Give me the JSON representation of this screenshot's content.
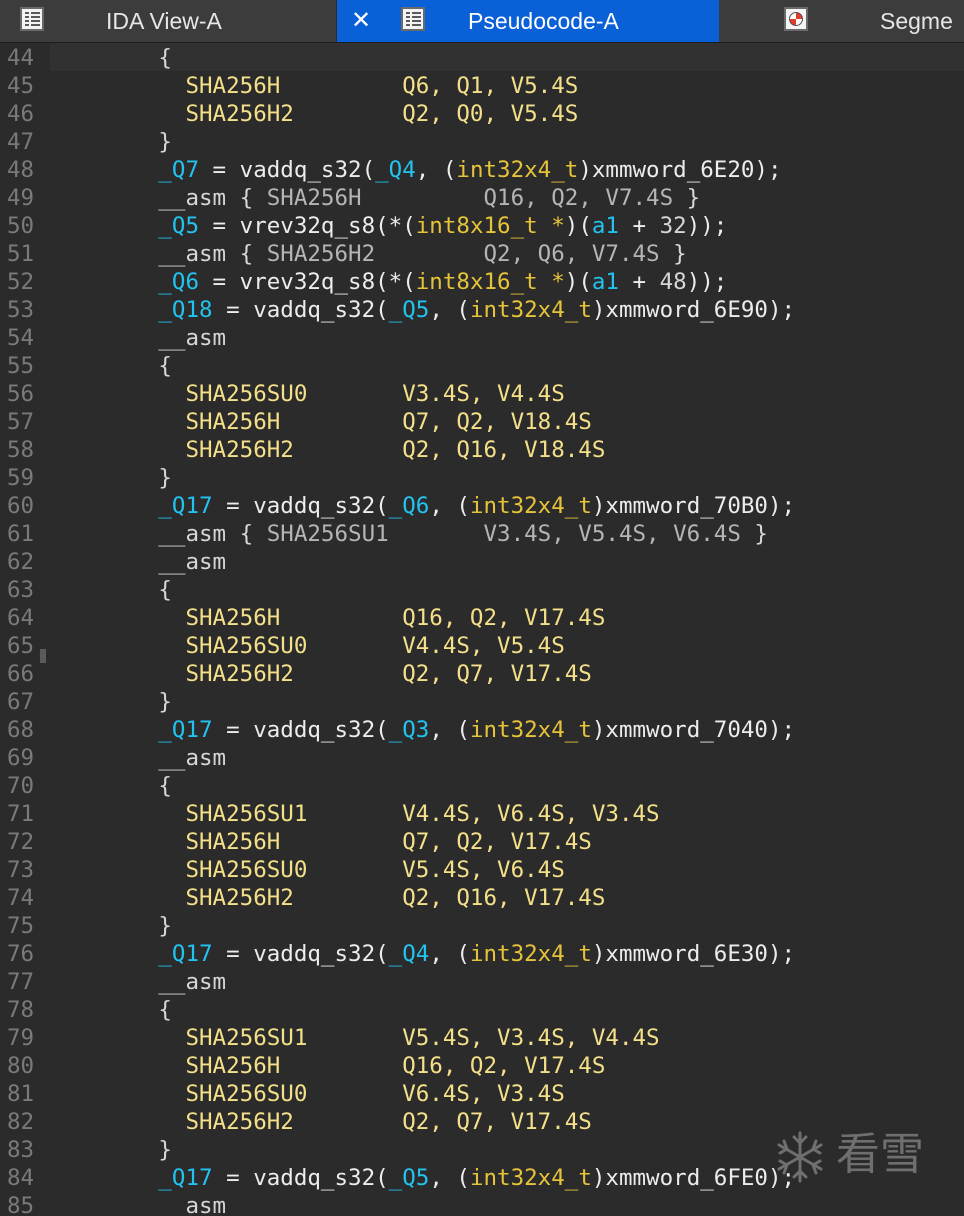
{
  "tabs": [
    {
      "label": "IDA View-A",
      "icon": "listing-icon",
      "active": false
    },
    {
      "label": "Pseudocode-A",
      "icon": "listing-icon",
      "active": true,
      "close": "✕"
    },
    {
      "label": "Segme",
      "icon": "segment-icon",
      "active": false
    }
  ],
  "colors": {
    "background": "#2b2b2b",
    "tab_active": "#0a60d6",
    "line_number": "#7a7a7a",
    "instruction": "#f5e08a",
    "variable": "#22c3ee",
    "type": "#e6c43a"
  },
  "code_lines": [
    {
      "n": "44",
      "tokens": [
        [
          "p",
          "        {"
        ]
      ]
    },
    {
      "n": "45",
      "tokens": [
        [
          "y",
          "          SHA256H         Q6, Q1, V5.4S"
        ]
      ]
    },
    {
      "n": "46",
      "tokens": [
        [
          "y",
          "          SHA256H2        Q2, Q0, V5.4S"
        ]
      ]
    },
    {
      "n": "47",
      "tokens": [
        [
          "p",
          "        }"
        ]
      ]
    },
    {
      "n": "48",
      "tokens": [
        [
          "p",
          "        "
        ],
        [
          "c",
          "_Q7"
        ],
        [
          "w",
          " = vaddq_s32("
        ],
        [
          "c",
          "_Q4"
        ],
        [
          "w",
          ", ("
        ],
        [
          "o",
          "int32x4_t"
        ],
        [
          "w",
          ")xmmword_6E20);"
        ]
      ]
    },
    {
      "n": "49",
      "tokens": [
        [
          "p",
          "        __asm { "
        ],
        [
          "g",
          "SHA256H         Q16, Q2, V7.4S"
        ],
        [
          "p",
          " }"
        ]
      ]
    },
    {
      "n": "50",
      "tokens": [
        [
          "p",
          "        "
        ],
        [
          "c",
          "_Q5"
        ],
        [
          "w",
          " = vrev32q_s8(*("
        ],
        [
          "o",
          "int8x16_t *"
        ],
        [
          "w",
          ")("
        ],
        [
          "c",
          "a1"
        ],
        [
          "w",
          " + "
        ],
        [
          "n",
          "32"
        ],
        [
          "w",
          "));"
        ]
      ]
    },
    {
      "n": "51",
      "tokens": [
        [
          "p",
          "        __asm { "
        ],
        [
          "g",
          "SHA256H2        Q2, Q6, V7.4S"
        ],
        [
          "p",
          " }"
        ]
      ]
    },
    {
      "n": "52",
      "tokens": [
        [
          "p",
          "        "
        ],
        [
          "c",
          "_Q6"
        ],
        [
          "w",
          " = vrev32q_s8(*("
        ],
        [
          "o",
          "int8x16_t *"
        ],
        [
          "w",
          ")("
        ],
        [
          "c",
          "a1"
        ],
        [
          "w",
          " + "
        ],
        [
          "n",
          "48"
        ],
        [
          "w",
          "));"
        ]
      ]
    },
    {
      "n": "53",
      "tokens": [
        [
          "p",
          "        "
        ],
        [
          "c",
          "_Q18"
        ],
        [
          "w",
          " = vaddq_s32("
        ],
        [
          "c",
          "_Q5"
        ],
        [
          "w",
          ", ("
        ],
        [
          "o",
          "int32x4_t"
        ],
        [
          "w",
          ")xmmword_6E90);"
        ]
      ]
    },
    {
      "n": "54",
      "tokens": [
        [
          "p",
          "        __asm"
        ]
      ]
    },
    {
      "n": "55",
      "tokens": [
        [
          "p",
          "        {"
        ]
      ]
    },
    {
      "n": "56",
      "tokens": [
        [
          "y",
          "          SHA256SU0       V3.4S, V4.4S"
        ]
      ]
    },
    {
      "n": "57",
      "tokens": [
        [
          "y",
          "          SHA256H         Q7, Q2, V18.4S"
        ]
      ]
    },
    {
      "n": "58",
      "tokens": [
        [
          "y",
          "          SHA256H2        Q2, Q16, V18.4S"
        ]
      ]
    },
    {
      "n": "59",
      "tokens": [
        [
          "p",
          "        }"
        ]
      ]
    },
    {
      "n": "60",
      "tokens": [
        [
          "p",
          "        "
        ],
        [
          "c",
          "_Q17"
        ],
        [
          "w",
          " = vaddq_s32("
        ],
        [
          "c",
          "_Q6"
        ],
        [
          "w",
          ", ("
        ],
        [
          "o",
          "int32x4_t"
        ],
        [
          "w",
          ")xmmword_70B0);"
        ]
      ]
    },
    {
      "n": "61",
      "tokens": [
        [
          "p",
          "        __asm { "
        ],
        [
          "g",
          "SHA256SU1       V3.4S, V5.4S, V6.4S"
        ],
        [
          "p",
          " }"
        ]
      ]
    },
    {
      "n": "62",
      "tokens": [
        [
          "p",
          "        __asm"
        ]
      ]
    },
    {
      "n": "63",
      "tokens": [
        [
          "p",
          "        {"
        ]
      ]
    },
    {
      "n": "64",
      "tokens": [
        [
          "y",
          "          SHA256H         Q16, Q2, V17.4S"
        ]
      ]
    },
    {
      "n": "65",
      "tokens": [
        [
          "y",
          "          SHA256SU0       V4.4S, V5.4S"
        ]
      ]
    },
    {
      "n": "66",
      "tokens": [
        [
          "y",
          "          SHA256H2        Q2, Q7, V17.4S"
        ]
      ]
    },
    {
      "n": "67",
      "tokens": [
        [
          "p",
          "        }"
        ]
      ]
    },
    {
      "n": "68",
      "tokens": [
        [
          "p",
          "        "
        ],
        [
          "c",
          "_Q17"
        ],
        [
          "w",
          " = vaddq_s32("
        ],
        [
          "c",
          "_Q3"
        ],
        [
          "w",
          ", ("
        ],
        [
          "o",
          "int32x4_t"
        ],
        [
          "w",
          ")xmmword_7040);"
        ]
      ]
    },
    {
      "n": "69",
      "tokens": [
        [
          "p",
          "        __asm"
        ]
      ]
    },
    {
      "n": "70",
      "tokens": [
        [
          "p",
          "        {"
        ]
      ]
    },
    {
      "n": "71",
      "tokens": [
        [
          "y",
          "          SHA256SU1       V4.4S, V6.4S, V3.4S"
        ]
      ]
    },
    {
      "n": "72",
      "tokens": [
        [
          "y",
          "          SHA256H         Q7, Q2, V17.4S"
        ]
      ]
    },
    {
      "n": "73",
      "tokens": [
        [
          "y",
          "          SHA256SU0       V5.4S, V6.4S"
        ]
      ]
    },
    {
      "n": "74",
      "tokens": [
        [
          "y",
          "          SHA256H2        Q2, Q16, V17.4S"
        ]
      ]
    },
    {
      "n": "75",
      "tokens": [
        [
          "p",
          "        }"
        ]
      ]
    },
    {
      "n": "76",
      "tokens": [
        [
          "p",
          "        "
        ],
        [
          "c",
          "_Q17"
        ],
        [
          "w",
          " = vaddq_s32("
        ],
        [
          "c",
          "_Q4"
        ],
        [
          "w",
          ", ("
        ],
        [
          "o",
          "int32x4_t"
        ],
        [
          "w",
          ")xmmword_6E30);"
        ]
      ]
    },
    {
      "n": "77",
      "tokens": [
        [
          "p",
          "        __asm"
        ]
      ]
    },
    {
      "n": "78",
      "tokens": [
        [
          "p",
          "        {"
        ]
      ]
    },
    {
      "n": "79",
      "tokens": [
        [
          "y",
          "          SHA256SU1       V5.4S, V3.4S, V4.4S"
        ]
      ]
    },
    {
      "n": "80",
      "tokens": [
        [
          "y",
          "          SHA256H         Q16, Q2, V17.4S"
        ]
      ]
    },
    {
      "n": "81",
      "tokens": [
        [
          "y",
          "          SHA256SU0       V6.4S, V3.4S"
        ]
      ]
    },
    {
      "n": "82",
      "tokens": [
        [
          "y",
          "          SHA256H2        Q2, Q7, V17.4S"
        ]
      ]
    },
    {
      "n": "83",
      "tokens": [
        [
          "p",
          "        }"
        ]
      ]
    },
    {
      "n": "84",
      "tokens": [
        [
          "p",
          "        "
        ],
        [
          "c",
          "_Q17"
        ],
        [
          "w",
          " = vaddq_s32("
        ],
        [
          "c",
          "_Q5"
        ],
        [
          "w",
          ", ("
        ],
        [
          "o",
          "int32x4_t"
        ],
        [
          "w",
          ")xmmword_6FE0);"
        ]
      ]
    },
    {
      "n": "85",
      "tokens": [
        [
          "p",
          "        __asm"
        ]
      ]
    }
  ],
  "watermark": {
    "text": "看雪",
    "icon": "snowflake-icon"
  }
}
